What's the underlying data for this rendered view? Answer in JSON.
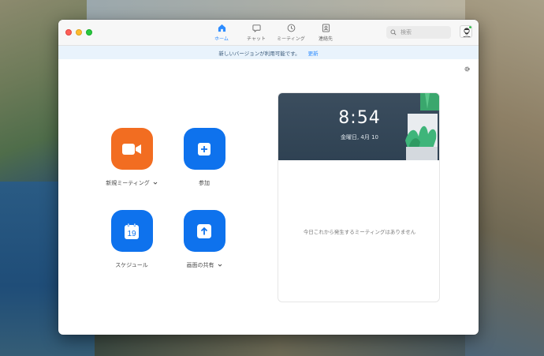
{
  "window": {
    "traffic_lights": [
      "close",
      "minimize",
      "maximize"
    ]
  },
  "nav": {
    "tabs": [
      {
        "label": "ホーム",
        "icon": "home-icon",
        "active": true
      },
      {
        "label": "チャット",
        "icon": "chat-icon",
        "active": false
      },
      {
        "label": "ミーティング",
        "icon": "clock-icon",
        "active": false
      },
      {
        "label": "連絡先",
        "icon": "contact-icon",
        "active": false
      }
    ]
  },
  "search": {
    "placeholder": "検索"
  },
  "update_banner": {
    "message": "新しいバージョンが利用可能です。",
    "action": "更新"
  },
  "actions": {
    "new_meeting": {
      "label": "新規ミーティング",
      "icon": "video-camera-icon",
      "color": "#f26d21"
    },
    "join": {
      "label": "参加",
      "icon": "plus-icon",
      "color": "#0e72ed"
    },
    "schedule": {
      "label": "スケジュール",
      "icon": "calendar-icon",
      "day": "19",
      "color": "#0e72ed"
    },
    "share_screen": {
      "label": "画面の共有",
      "icon": "share-up-arrow-icon",
      "color": "#0e72ed"
    }
  },
  "upcoming": {
    "time": "8:54",
    "date": "金曜日, 4月 10",
    "empty_message": "今日これから発生するミーティングはありません"
  },
  "colors": {
    "accent": "#2d8cff",
    "orange": "#f26d21",
    "blue": "#0e72ed"
  }
}
